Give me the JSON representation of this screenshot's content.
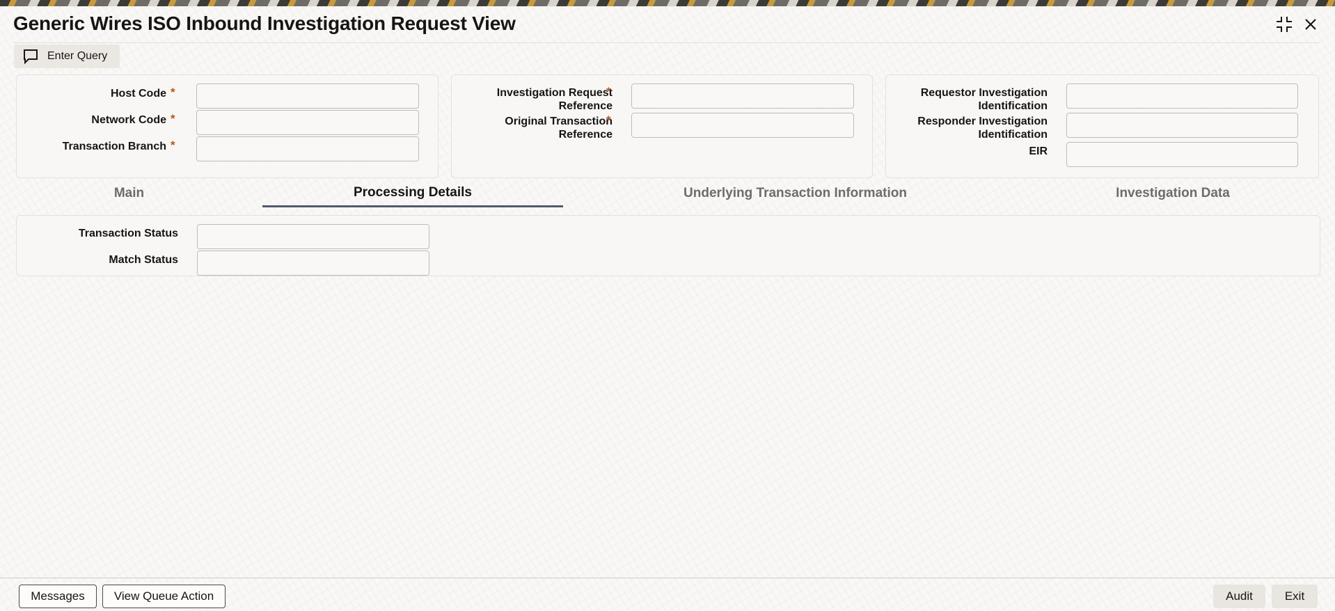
{
  "window": {
    "title": "Generic Wires ISO Inbound Investigation Request View"
  },
  "toolbar": {
    "enter_query_label": "Enter Query",
    "enter_query_icon": "chat-bubble-icon"
  },
  "header_fields": {
    "host_code": {
      "label": "Host Code",
      "required": "*",
      "value": ""
    },
    "network_code": {
      "label": "Network Code",
      "required": "*",
      "value": ""
    },
    "transaction_branch": {
      "label": "Transaction Branch",
      "required": "*",
      "value": ""
    },
    "investigation_request_reference": {
      "label_line1": "Investigation Request",
      "label_line2": "Reference",
      "required": "*",
      "value": ""
    },
    "original_transaction_reference": {
      "label_line1": "Original Transaction",
      "label_line2": "Reference",
      "required": "*",
      "value": ""
    },
    "requestor_investigation_identification": {
      "label_line1": "Requestor Investigation",
      "label_line2": "Identification",
      "value": ""
    },
    "responder_investigation_identification": {
      "label_line1": "Responder Investigation",
      "label_line2": "Identification",
      "value": ""
    },
    "eir": {
      "label": "EIR",
      "value": ""
    }
  },
  "tabs": [
    {
      "label": "Main",
      "active": false
    },
    {
      "label": "Processing Details",
      "active": true
    },
    {
      "label": "Underlying Transaction Information",
      "active": false
    },
    {
      "label": "Investigation Data",
      "active": false
    }
  ],
  "processing_details": {
    "transaction_status": {
      "label": "Transaction Status",
      "value": ""
    },
    "match_status": {
      "label": "Match Status",
      "value": ""
    }
  },
  "footer": {
    "messages_label": "Messages",
    "view_queue_action_label": "View Queue Action",
    "audit_label": "Audit",
    "exit_label": "Exit"
  },
  "colors": {
    "required_marker": "#b4571a",
    "active_tab_underline": "#515a72"
  }
}
